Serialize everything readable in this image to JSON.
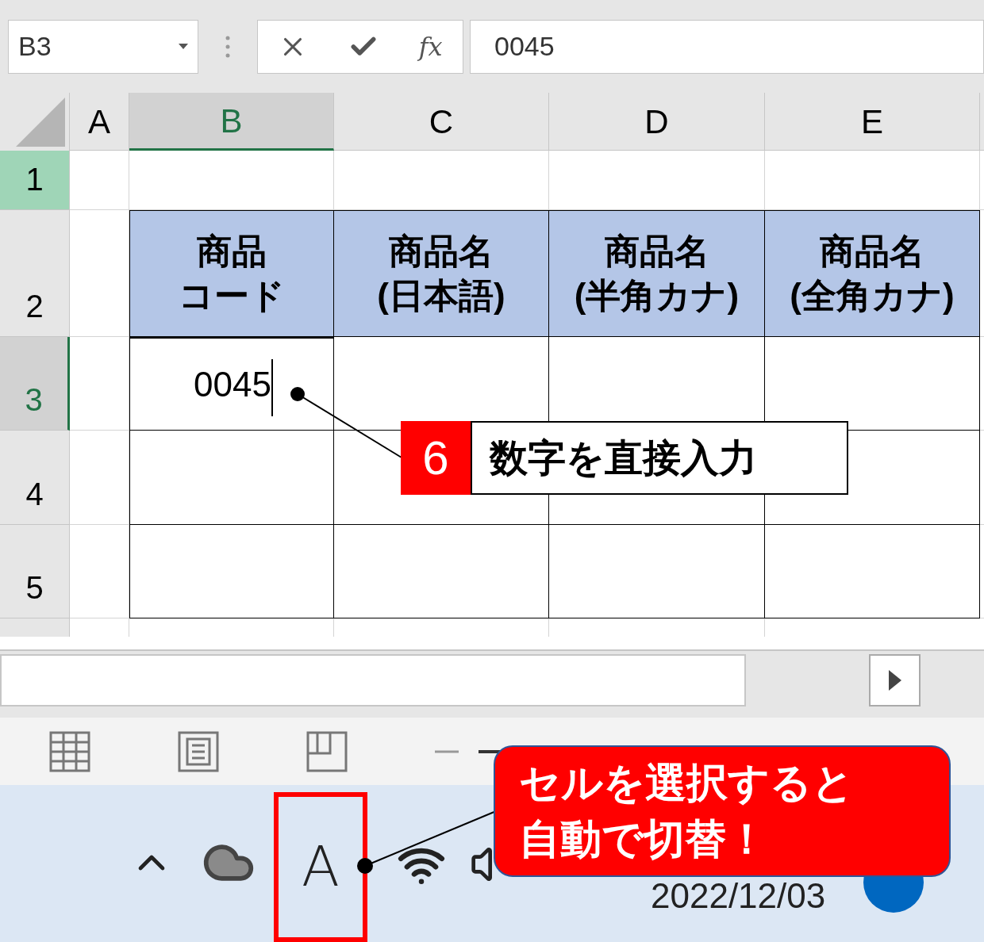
{
  "name_box": {
    "value": "B3"
  },
  "formula_bar": {
    "function_label": "fx",
    "value": "0045"
  },
  "columns": [
    {
      "label": "A",
      "selected": false
    },
    {
      "label": "B",
      "selected": true
    },
    {
      "label": "C",
      "selected": false
    },
    {
      "label": "D",
      "selected": false
    },
    {
      "label": "E",
      "selected": false
    }
  ],
  "rows": [
    {
      "label": "1",
      "selected": false,
      "highlighted": true
    },
    {
      "label": "2",
      "selected": false,
      "highlighted": false
    },
    {
      "label": "3",
      "selected": true,
      "highlighted": false
    },
    {
      "label": "4",
      "selected": false,
      "highlighted": false
    },
    {
      "label": "5",
      "selected": false,
      "highlighted": false
    }
  ],
  "table": {
    "header_cells": [
      {
        "lines": [
          "商品",
          "コード"
        ]
      },
      {
        "lines": [
          "商品名",
          "(日本語)"
        ]
      },
      {
        "lines": [
          "商品名",
          "(半角カナ)"
        ]
      },
      {
        "lines": [
          "商品名",
          "(全角カナ)"
        ]
      }
    ],
    "active_cell": {
      "value": "0045"
    }
  },
  "callouts": [
    {
      "number": "6",
      "lines": [
        "数字を直接入力"
      ]
    },
    {
      "lines": [
        "セルを選択すると",
        "自動で切替！"
      ]
    }
  ],
  "taskbar": {
    "ime_indicator": "A",
    "date": "2022/12/03"
  }
}
